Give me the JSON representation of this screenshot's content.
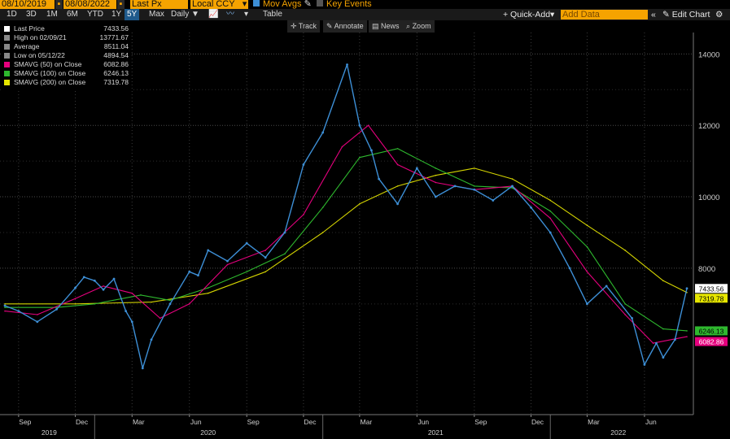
{
  "toolbar": {
    "start_date": "08/10/2019",
    "end_date": "08/08/2022",
    "price_field": "Last Px",
    "currency": "Local CCY",
    "mov_avgs": "Mov Avgs",
    "key_events": "Key Events",
    "ranges": [
      "1D",
      "3D",
      "1M",
      "6M",
      "YTD",
      "1Y",
      "5Y",
      "Max"
    ],
    "selected_range": "5Y",
    "frequency": "Daily",
    "table_label": "Table",
    "quick_add": "+ Quick-Add",
    "add_data_placeholder": "Add Data",
    "edit_chart": "Edit Chart",
    "tools": [
      "Track",
      "Annotate",
      "News",
      "Zoom"
    ]
  },
  "legend": [
    {
      "label": "Last Price",
      "value": "7433.56",
      "color": "#ffffff"
    },
    {
      "label": "High on 02/09/21",
      "value": "13771.67",
      "color": "#888888"
    },
    {
      "label": "Average",
      "value": "8511.04",
      "color": "#888888"
    },
    {
      "label": "Low on 05/12/22",
      "value": "4894.54",
      "color": "#888888"
    },
    {
      "label": "SMAVG (50)  on Close",
      "value": "6082.86",
      "color": "#e6007e"
    },
    {
      "label": "SMAVG (100)  on Close",
      "value": "6246.13",
      "color": "#2eb82e"
    },
    {
      "label": "SMAVG (200)  on Close",
      "value": "7319.78",
      "color": "#e6e600"
    }
  ],
  "chart_data": {
    "type": "line",
    "title": "",
    "ylim": [
      3900,
      14600
    ],
    "y_ticks": [
      8000,
      10000,
      12000,
      14000
    ],
    "x_month_labels": [
      "Sep",
      "Dec",
      "Mar",
      "Jun",
      "Sep",
      "Dec",
      "Mar",
      "Jun",
      "Sep",
      "Dec",
      "Mar",
      "Jun"
    ],
    "x_year_labels": [
      "2019",
      "2020",
      "2021",
      "2022"
    ],
    "x_start": "2019-08-10",
    "x_end": "2022-08-08",
    "grid": true,
    "price_labels": [
      {
        "text": "7433.56",
        "bg": "#ffffff",
        "fg": "#000000",
        "value": 7433.56
      },
      {
        "text": "7319.78",
        "bg": "#e6e600",
        "fg": "#000000",
        "value": 7319.78
      },
      {
        "text": "6246.13",
        "bg": "#2eb82e",
        "fg": "#000000",
        "value": 6246.13
      },
      {
        "text": "6082.86",
        "bg": "#e6007e",
        "fg": "#ffffff",
        "value": 6082.86
      }
    ],
    "series": [
      {
        "name": "Last Price",
        "color": "#3d8fd6",
        "x": [
          "2019-08-10",
          "2019-09-01",
          "2019-10-01",
          "2019-11-01",
          "2019-12-01",
          "2019-12-15",
          "2020-01-01",
          "2020-01-15",
          "2020-02-01",
          "2020-02-20",
          "2020-03-01",
          "2020-03-18",
          "2020-04-01",
          "2020-05-01",
          "2020-06-01",
          "2020-06-15",
          "2020-07-01",
          "2020-08-01",
          "2020-09-01",
          "2020-10-01",
          "2020-11-01",
          "2020-12-01",
          "2021-01-01",
          "2021-02-09",
          "2021-03-01",
          "2021-03-20",
          "2021-04-01",
          "2021-05-01",
          "2021-06-01",
          "2021-07-01",
          "2021-08-01",
          "2021-09-01",
          "2021-10-01",
          "2021-11-01",
          "2021-12-01",
          "2022-01-01",
          "2022-02-01",
          "2022-03-01",
          "2022-04-01",
          "2022-05-12",
          "2022-06-01",
          "2022-06-20",
          "2022-07-01",
          "2022-07-20",
          "2022-08-08"
        ],
        "values": [
          6950,
          6800,
          6500,
          6850,
          7450,
          7750,
          7650,
          7400,
          7700,
          6800,
          6500,
          5200,
          6000,
          7000,
          7900,
          7800,
          8500,
          8200,
          8700,
          8300,
          9000,
          10900,
          11800,
          13700,
          12000,
          11300,
          10500,
          9800,
          10800,
          10000,
          10300,
          10200,
          9900,
          10300,
          9700,
          9000,
          8000,
          7000,
          7500,
          6600,
          5300,
          5900,
          5500,
          6000,
          7433.56
        ]
      },
      {
        "name": "SMAVG (50)",
        "color": "#e6007e",
        "x": [
          "2019-08-10",
          "2019-10-01",
          "2019-12-01",
          "2020-01-15",
          "2020-03-01",
          "2020-04-15",
          "2020-06-01",
          "2020-08-01",
          "2020-10-01",
          "2020-12-01",
          "2021-02-01",
          "2021-03-15",
          "2021-05-01",
          "2021-07-01",
          "2021-09-01",
          "2021-11-01",
          "2022-01-01",
          "2022-03-01",
          "2022-05-01",
          "2022-06-15",
          "2022-08-08"
        ],
        "values": [
          6800,
          6700,
          7150,
          7500,
          7300,
          6600,
          7000,
          8100,
          8500,
          9500,
          11400,
          12000,
          10900,
          10400,
          10200,
          10300,
          9400,
          7900,
          6700,
          5900,
          6082.86
        ]
      },
      {
        "name": "SMAVG (100)",
        "color": "#2eb82e",
        "x": [
          "2019-08-10",
          "2019-11-01",
          "2020-01-01",
          "2020-03-15",
          "2020-05-01",
          "2020-07-01",
          "2020-09-01",
          "2020-11-01",
          "2021-01-01",
          "2021-03-01",
          "2021-05-01",
          "2021-07-01",
          "2021-09-01",
          "2021-11-01",
          "2022-01-01",
          "2022-03-01",
          "2022-05-01",
          "2022-07-01",
          "2022-08-08"
        ],
        "values": [
          6900,
          6900,
          7000,
          7250,
          7100,
          7450,
          7900,
          8400,
          9700,
          11100,
          11350,
          10800,
          10300,
          10250,
          9600,
          8600,
          7000,
          6300,
          6246.13
        ]
      },
      {
        "name": "SMAVG (200)",
        "color": "#d4d400",
        "x": [
          "2019-08-10",
          "2019-12-01",
          "2020-04-01",
          "2020-07-01",
          "2020-10-01",
          "2021-01-01",
          "2021-03-01",
          "2021-05-01",
          "2021-07-01",
          "2021-09-01",
          "2021-11-01",
          "2022-01-01",
          "2022-03-01",
          "2022-05-01",
          "2022-07-01",
          "2022-08-08"
        ],
        "values": [
          7000,
          7000,
          7050,
          7300,
          7900,
          9000,
          9800,
          10300,
          10600,
          10800,
          10500,
          9900,
          9200,
          8500,
          7650,
          7319.78
        ]
      }
    ]
  }
}
